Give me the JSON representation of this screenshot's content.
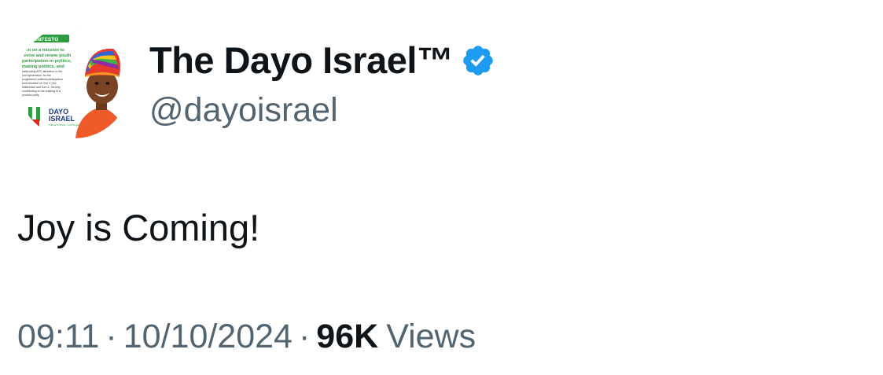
{
  "author": {
    "display_name": "The Dayo Israel™",
    "handle": "@dayoisrael",
    "verified": true,
    "verified_color": "#1d9bf0",
    "avatar": {
      "badge": "MANIFESTO",
      "lines": [
        "I am on a mission to",
        "revive and renew youth",
        "participation in politics,",
        "making politics, and",
        "particularly APC attractive to the",
        "next generation, for the",
        "progressive political participation",
        "and elevation of Gen Y (the",
        "Millennials and Gen Z, thereby",
        "contributing to the building of a",
        "youthful party."
      ],
      "logo_line1": "DAYO",
      "logo_line2": "ISRAEL",
      "logo_sub": "FOR NATIONAL YOUTH LEADER"
    }
  },
  "tweet": {
    "text": "Joy is Coming!"
  },
  "meta": {
    "time": "09:11",
    "separator": "·",
    "date": "10/10/2024",
    "views_count": "96K",
    "views_label": "Views"
  },
  "colors": {
    "text_primary": "#0f1419",
    "text_secondary": "#536471",
    "brand_green": "#2e9d3f"
  }
}
